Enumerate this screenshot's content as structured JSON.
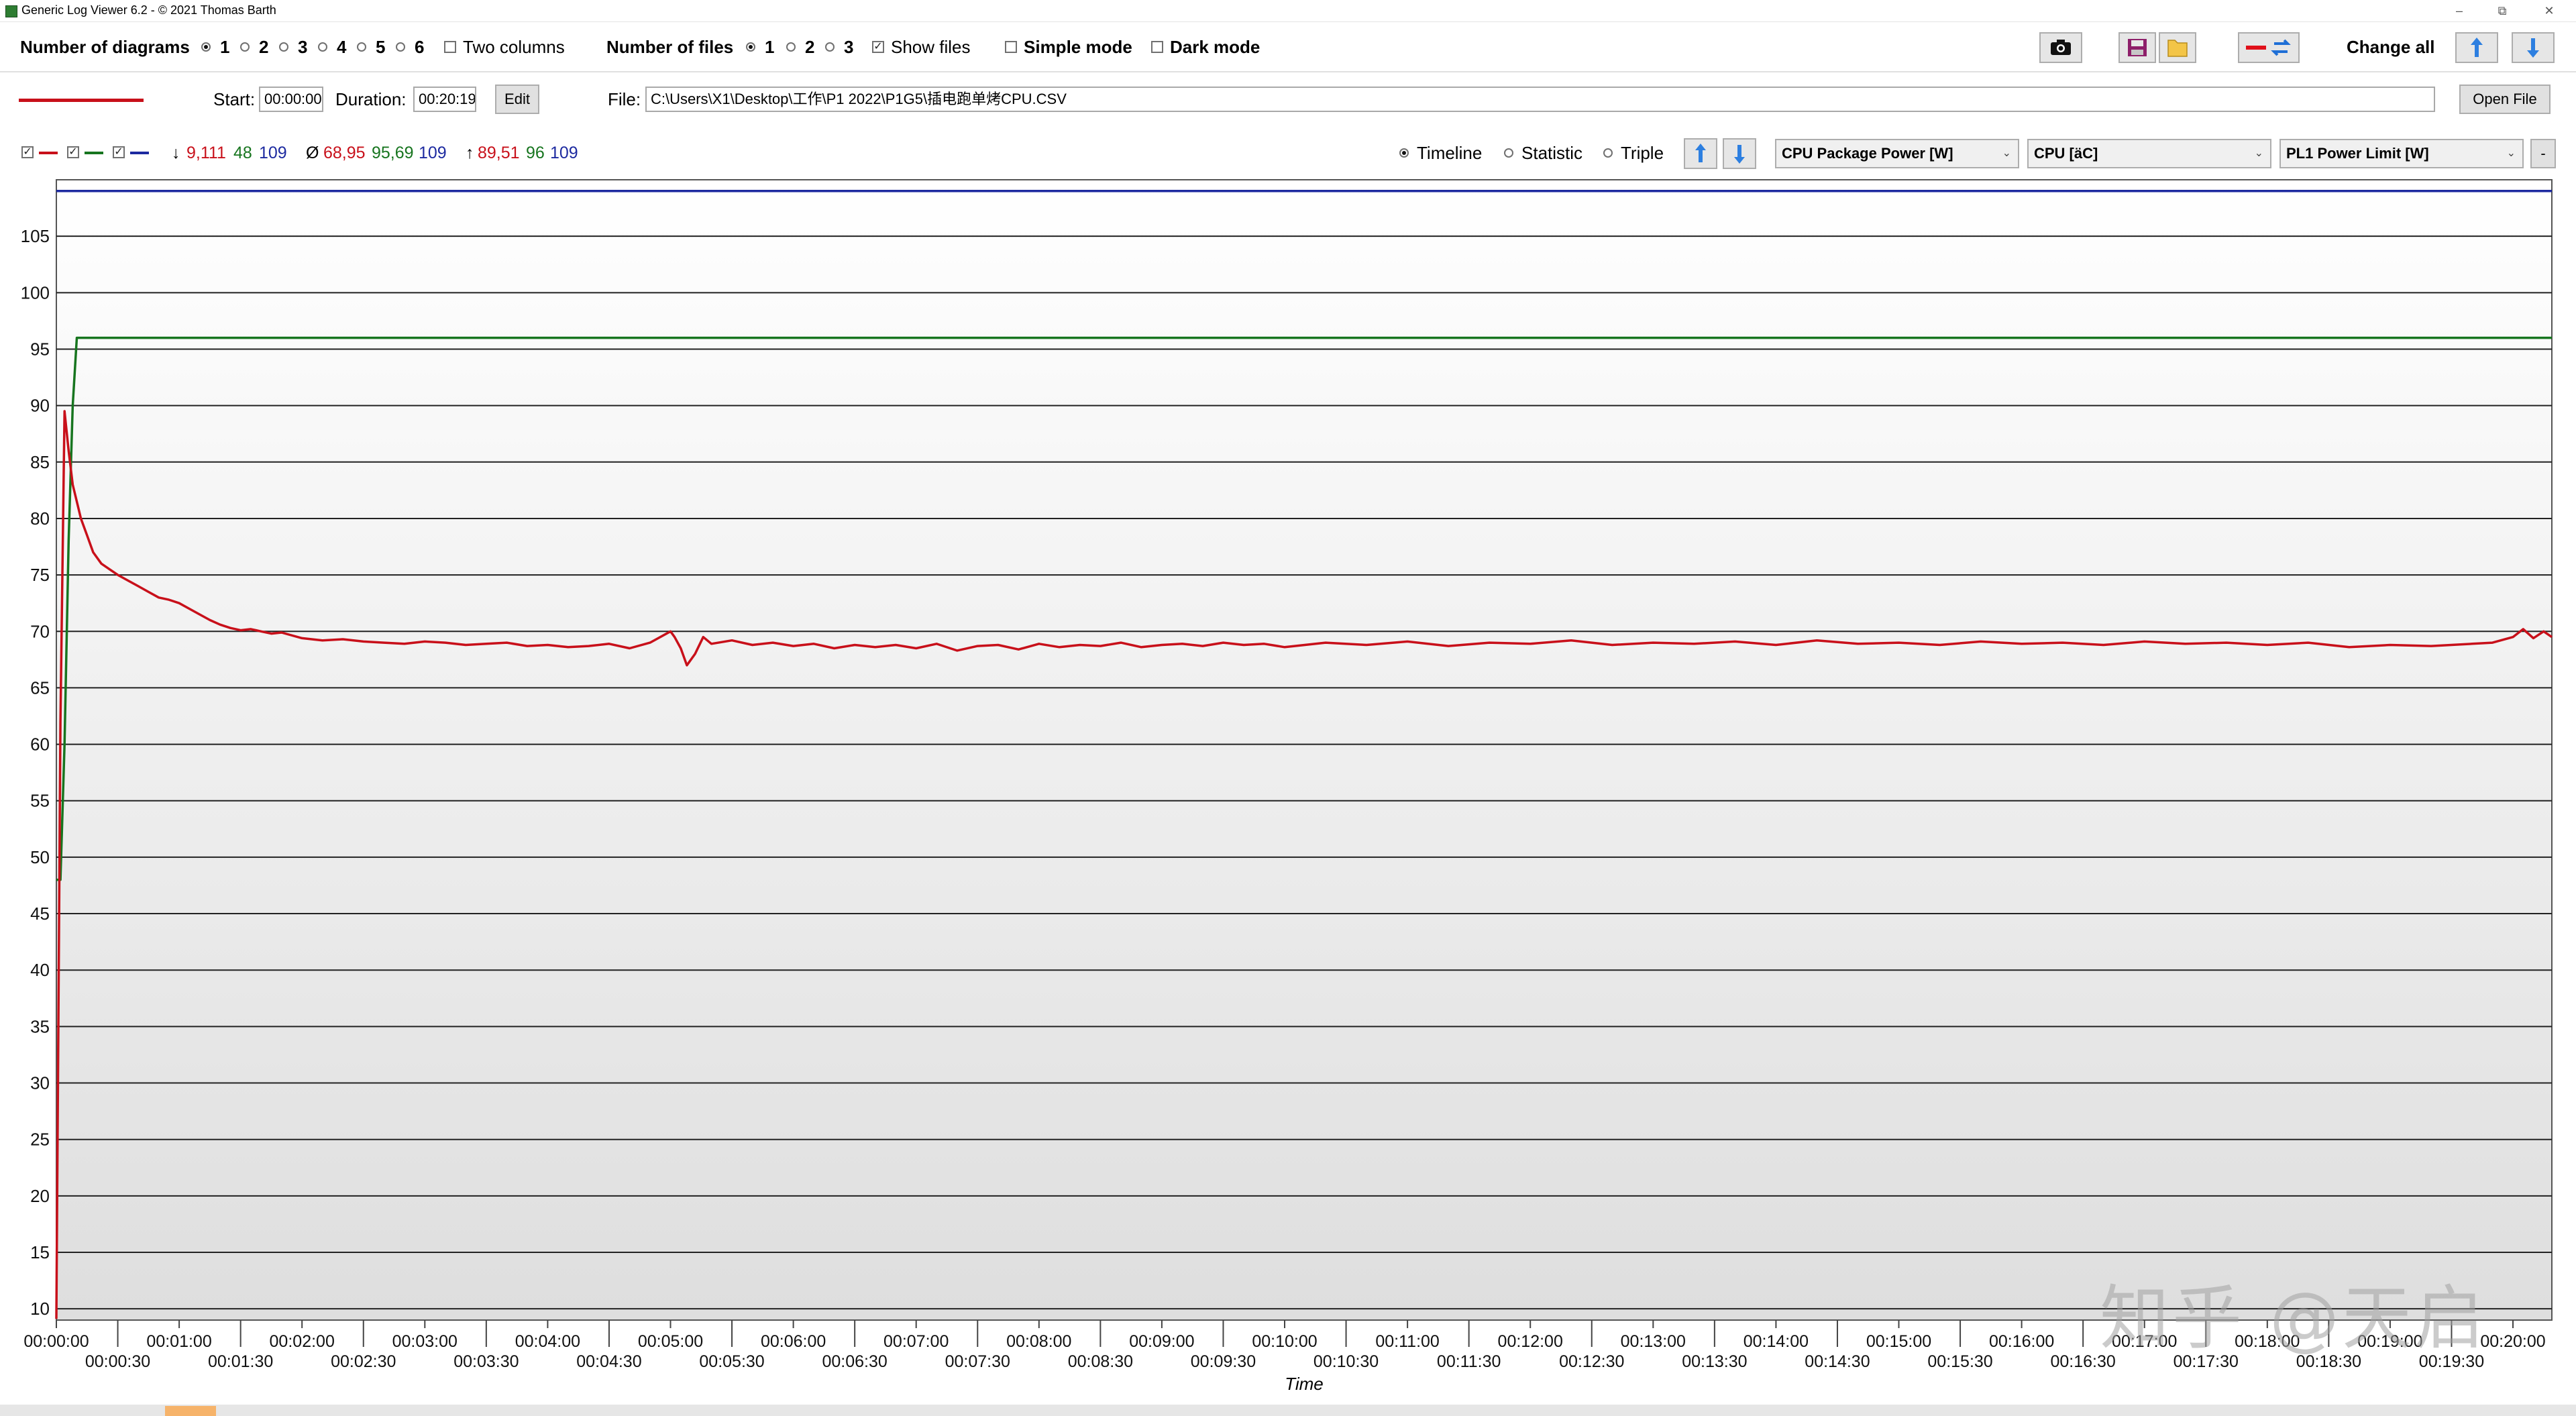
{
  "window": {
    "title": "Generic Log Viewer 6.2 - © 2021 Thomas Barth",
    "controls": [
      "–",
      "⧉",
      "✕"
    ]
  },
  "toolbar": {
    "diagrams_label": "Number of diagrams",
    "diagram_options": [
      "1",
      "2",
      "3",
      "4",
      "5",
      "6"
    ],
    "diagram_selected": "1",
    "two_columns_label": "Two columns",
    "files_label": "Number of files",
    "file_options": [
      "1",
      "2",
      "3"
    ],
    "file_selected": "1",
    "show_files_label": "Show files",
    "show_files_checked": true,
    "simple_mode_label": "Simple mode",
    "dark_mode_label": "Dark mode",
    "change_all_label": "Change all"
  },
  "file_row": {
    "start_label": "Start:",
    "start_value": "00:00:00",
    "duration_label": "Duration:",
    "duration_value": "00:20:19",
    "edit_label": "Edit",
    "file_label": "File:",
    "file_path": "C:\\Users\\X1\\Desktop\\工作\\P1 2022\\P1G5\\插电跑单烤CPU.CSV",
    "open_file_label": "Open File"
  },
  "stats": {
    "min_symbol": "↓",
    "min_values": [
      "9,111",
      "48",
      "109"
    ],
    "avg_symbol": "Ø",
    "avg_values": [
      "68,95",
      "95,69",
      "109"
    ],
    "max_symbol": "↑",
    "max_values": [
      "89,51",
      "96",
      "109"
    ]
  },
  "view": {
    "timeline_label": "Timeline",
    "statistic_label": "Statistic",
    "triple_label": "Triple",
    "selected": "Timeline",
    "combo1": "CPU Package Power [W]",
    "combo2": "CPU [äC]",
    "combo3": "PL1 Power Limit [W]",
    "minus_label": "-"
  },
  "colors": {
    "series1": "#c8101a",
    "series2": "#17751f",
    "series3": "#1d2aa0",
    "grid": "#222222",
    "gradient_top": "#ffffff",
    "gradient_bottom": "#dedede"
  },
  "watermark": "知乎 @天启",
  "chart_data": {
    "type": "line",
    "xlabel": "Time",
    "ylim": [
      9,
      110
    ],
    "yticks": [
      10,
      15,
      20,
      25,
      30,
      35,
      40,
      45,
      50,
      55,
      60,
      65,
      70,
      75,
      80,
      85,
      90,
      95,
      100,
      105
    ],
    "xticks_seconds": [
      0,
      30,
      60,
      90,
      120,
      150,
      180,
      210,
      240,
      270,
      300,
      330,
      360,
      390,
      420,
      450,
      480,
      510,
      540,
      570,
      600,
      630,
      660,
      690,
      720,
      750,
      780,
      810,
      840,
      870,
      900,
      930,
      960,
      990,
      1020,
      1050,
      1080,
      1110,
      1140,
      1170,
      1200
    ],
    "xtick_labels": [
      "00:00:00",
      "00:00:30",
      "00:01:00",
      "00:01:30",
      "00:02:00",
      "00:02:30",
      "00:03:00",
      "00:03:30",
      "00:04:00",
      "00:04:30",
      "00:05:00",
      "00:05:30",
      "00:06:00",
      "00:06:30",
      "00:07:00",
      "00:07:30",
      "00:08:00",
      "00:08:30",
      "00:09:00",
      "00:09:30",
      "00:10:00",
      "00:10:30",
      "00:11:00",
      "00:11:30",
      "00:12:00",
      "00:12:30",
      "00:13:00",
      "00:13:30",
      "00:14:00",
      "00:14:30",
      "00:15:00",
      "00:15:30",
      "00:16:00",
      "00:16:30",
      "00:17:00",
      "00:17:30",
      "00:18:00",
      "00:18:30",
      "00:19:00",
      "00:19:30",
      "00:20:00"
    ],
    "xmax_seconds": 1219,
    "grid": true,
    "series": [
      {
        "x": [
          0,
          2,
          4,
          6,
          8,
          10,
          12,
          15,
          18,
          22,
          26,
          30,
          35,
          40,
          45,
          50,
          55,
          60,
          65,
          70,
          75,
          80,
          85,
          90,
          95,
          100,
          105,
          110,
          120,
          130,
          140,
          150,
          160,
          170,
          180,
          190,
          200,
          210,
          220,
          230,
          240,
          250,
          260,
          270,
          280,
          290,
          300,
          302,
          305,
          308,
          312,
          316,
          320,
          330,
          340,
          350,
          360,
          370,
          380,
          390,
          400,
          410,
          420,
          430,
          440,
          450,
          460,
          470,
          480,
          490,
          500,
          510,
          520,
          530,
          540,
          550,
          560,
          570,
          580,
          590,
          600,
          620,
          640,
          660,
          680,
          700,
          720,
          740,
          760,
          780,
          800,
          820,
          840,
          860,
          880,
          900,
          920,
          940,
          960,
          980,
          1000,
          1020,
          1040,
          1060,
          1080,
          1100,
          1120,
          1140,
          1160,
          1180,
          1190,
          1200,
          1205,
          1210,
          1215,
          1219
        ],
        "values": [
          9.1,
          62,
          89.5,
          86,
          83,
          81.5,
          80,
          78.5,
          77,
          76,
          75.5,
          75,
          74.5,
          74,
          73.5,
          73,
          72.8,
          72.5,
          72,
          71.5,
          71,
          70.6,
          70.3,
          70.1,
          70.2,
          70,
          69.8,
          69.9,
          69.4,
          69.2,
          69.3,
          69.1,
          69.0,
          68.9,
          69.1,
          69.0,
          68.8,
          68.9,
          69.0,
          68.7,
          68.8,
          68.6,
          68.7,
          68.9,
          68.5,
          69.0,
          70.0,
          69.5,
          68.5,
          67.0,
          68.0,
          69.5,
          68.9,
          69.2,
          68.8,
          69.0,
          68.7,
          68.9,
          68.5,
          68.8,
          68.6,
          68.8,
          68.5,
          68.9,
          68.3,
          68.7,
          68.8,
          68.4,
          68.9,
          68.6,
          68.8,
          68.7,
          69.0,
          68.6,
          68.8,
          68.9,
          68.7,
          69.0,
          68.8,
          68.9,
          68.6,
          69.0,
          68.8,
          69.1,
          68.7,
          69.0,
          68.9,
          69.2,
          68.8,
          69.0,
          68.9,
          69.1,
          68.8,
          69.2,
          68.9,
          69.0,
          68.8,
          69.1,
          68.9,
          69.0,
          68.8,
          69.1,
          68.9,
          69.0,
          68.8,
          69.0,
          68.6,
          68.8,
          68.7,
          68.9,
          69.0,
          69.5,
          70.2,
          69.4,
          70.0,
          69.5
        ]
      },
      {
        "x": [
          0,
          2,
          4,
          6,
          8,
          10,
          12,
          1219
        ],
        "values": [
          48,
          48,
          60,
          78,
          90,
          96,
          96,
          96
        ]
      },
      {
        "x": [
          0,
          1219
        ],
        "values": [
          109,
          109
        ]
      }
    ]
  }
}
